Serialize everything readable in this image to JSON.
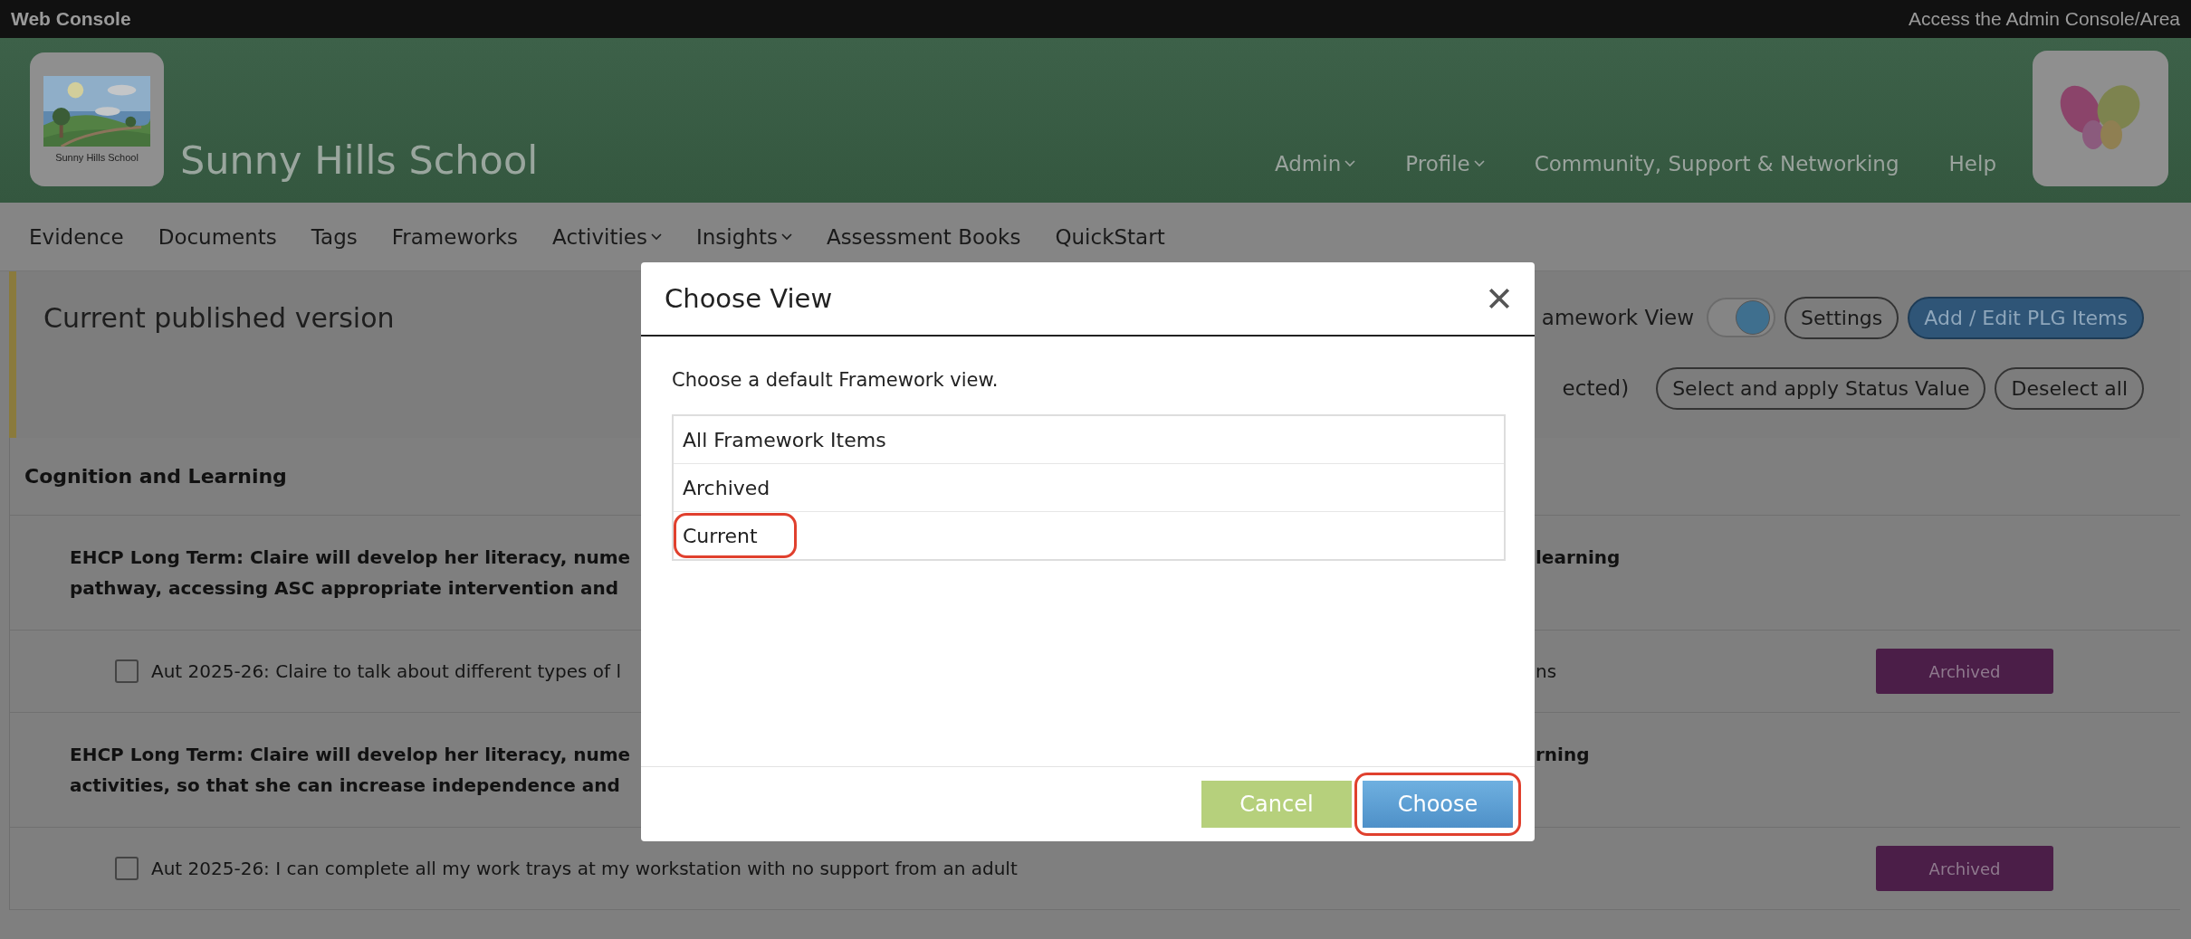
{
  "top_bar": {
    "title": "Web Console",
    "admin_link": "Access the Admin Console/Area"
  },
  "header": {
    "logo_caption": "Sunny Hills School",
    "school_name": "Sunny Hills School",
    "nav": [
      {
        "label": "Admin",
        "dropdown": true
      },
      {
        "label": "Profile",
        "dropdown": true
      },
      {
        "label": "Community, Support & Networking",
        "dropdown": false
      },
      {
        "label": "Help",
        "dropdown": false
      }
    ]
  },
  "menu": [
    {
      "label": "Evidence",
      "dropdown": false
    },
    {
      "label": "Documents",
      "dropdown": false
    },
    {
      "label": "Tags",
      "dropdown": false
    },
    {
      "label": "Frameworks",
      "dropdown": false
    },
    {
      "label": "Activities",
      "dropdown": true
    },
    {
      "label": "Insights",
      "dropdown": true
    },
    {
      "label": "Assessment Books",
      "dropdown": false
    },
    {
      "label": "QuickStart",
      "dropdown": false
    }
  ],
  "panel": {
    "title": "Current published version",
    "view_label": "amework View",
    "view_toggle": {
      "on": true
    },
    "buttons": [
      {
        "label": "Settings",
        "kind": "outline"
      },
      {
        "label": "Add / Edit PLG Items",
        "kind": "primary"
      }
    ],
    "selection_label": "ected)",
    "selection_buttons": [
      {
        "label": "Select and apply Status Value",
        "kind": "outline"
      },
      {
        "label": "Deselect all",
        "kind": "outline"
      }
    ]
  },
  "section": {
    "title": "Cognition and Learning",
    "rows": [
      {
        "kind": "heading",
        "lines": [
          "EHCP Long Term: Claire will develop her literacy, nume",
          "pathway, accessing ASC appropriate intervention and"
        ],
        "tail": "learning"
      },
      {
        "kind": "item",
        "checked": false,
        "text": "Aut 2025-26: Claire to talk about different types of l",
        "tail": "ns",
        "status": "Archived"
      },
      {
        "kind": "heading",
        "lines": [
          "EHCP Long Term: Claire will develop her literacy, nume",
          "activities, so that she can increase independence and"
        ],
        "tail": "rning"
      },
      {
        "kind": "item",
        "checked": false,
        "text": "Aut 2025-26: I can complete all my work trays at my workstation with no support from an adult",
        "status": "Archived"
      }
    ]
  },
  "dialog": {
    "title": "Choose View",
    "prompt": "Choose a default Framework view.",
    "options": [
      {
        "label": "All Framework Items",
        "annotated": false
      },
      {
        "label": "Archived",
        "annotated": false
      },
      {
        "label": "Current",
        "annotated": true
      }
    ],
    "buttons": [
      {
        "label": "Cancel",
        "kind": "cancel",
        "annotated": false
      },
      {
        "label": "Choose",
        "kind": "confirm",
        "annotated": true
      }
    ]
  }
}
